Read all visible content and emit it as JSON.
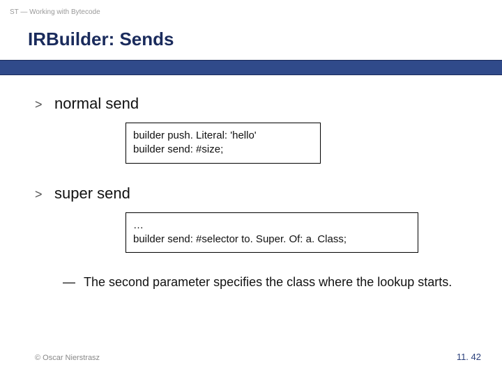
{
  "header": {
    "label": "ST — Working with Bytecode"
  },
  "title": "IRBuilder: Sends",
  "sections": [
    {
      "bullet": ">",
      "label": "normal send",
      "code": "builder push. Literal: 'hello'\nbuilder send: #size;"
    },
    {
      "bullet": ">",
      "label": "super send",
      "code": "…\nbuilder send: #selector to. Super. Of: a. Class;",
      "code_wide": true
    }
  ],
  "note": {
    "dash": "—",
    "text": "The second parameter specifies the class where the lookup starts."
  },
  "footer": {
    "copyright": "© Oscar Nierstrasz",
    "page": "11. 42"
  }
}
